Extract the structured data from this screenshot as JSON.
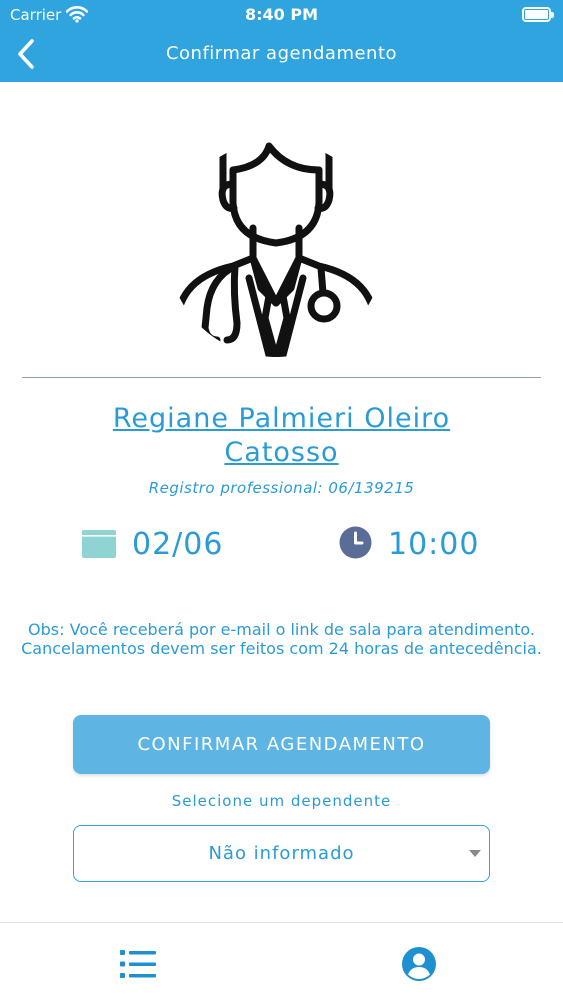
{
  "status_bar": {
    "carrier": "Carrier",
    "time": "8:40 PM",
    "icons": [
      "wifi-icon",
      "battery-icon"
    ]
  },
  "header": {
    "title": "Confirmar agendamento",
    "back_icon": "chevron-left-icon",
    "background_color": "#2fa4de"
  },
  "professional": {
    "avatar_icon": "doctor-avatar-icon",
    "name_line1": "Regiane Palmieri Oleiro",
    "name_line2": "Catosso",
    "registro_label": "Registro professional:",
    "registro_value": "06/139215"
  },
  "appointment": {
    "date_icon": "calendar-icon",
    "date": "02/06",
    "time_icon": "clock-icon",
    "time": "10:00"
  },
  "note": {
    "text": "Obs: Você receberá por e-mail o link de sala para atendimento. Cancelamentos devem ser feitos com 24 horas de antecedência."
  },
  "actions": {
    "confirm_label": "CONFIRMAR AGENDAMENTO",
    "confirm_color": "#5eb5e3"
  },
  "dependent": {
    "label": "Selecione um dependente",
    "selected": "Não informado",
    "caret_icon": "caret-down-icon"
  },
  "tab_bar": {
    "items": [
      {
        "icon": "list-icon"
      },
      {
        "icon": "user-circle-icon"
      }
    ]
  },
  "colors": {
    "accent": "#2b9bd6",
    "calendar": "#8fd3d3",
    "clock": "#5a6d99",
    "tab_icon": "#1e8fcf"
  }
}
